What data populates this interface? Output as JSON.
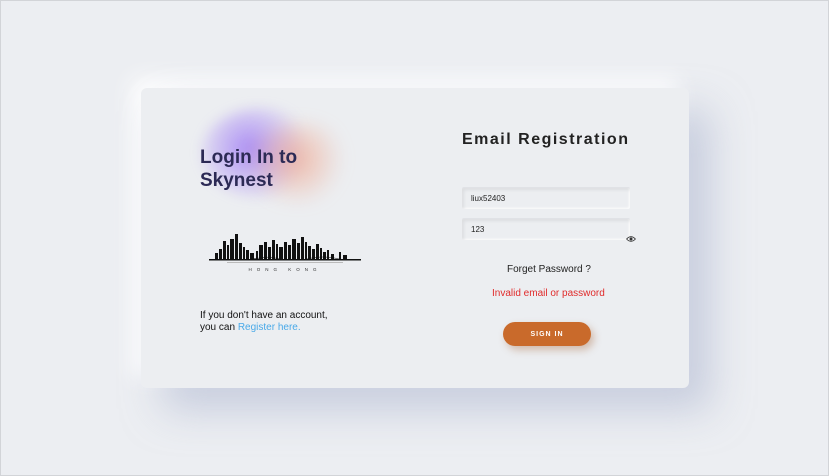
{
  "left_panel": {
    "title": "Login In to Skynest",
    "register_prefix_line1": "If you don't have an account,",
    "register_prefix_line2": "you can ",
    "register_link": "Register here.",
    "skyline_caption": "HONG KONG"
  },
  "form": {
    "title": "Email Registration",
    "email_value": "liux52403",
    "password_value": "123",
    "forget_password": "Forget Password ?",
    "error_message": "Invalid email or password",
    "signin_label": "SIGN IN"
  },
  "colors": {
    "background": "#eceef2",
    "title_text": "#2c2a55",
    "link": "#49a9e8",
    "error": "#e02b2b",
    "button": "#c96a2b"
  },
  "icons": {
    "password_toggle": "eye-icon",
    "logo": "hong-kong-skyline-logo"
  }
}
